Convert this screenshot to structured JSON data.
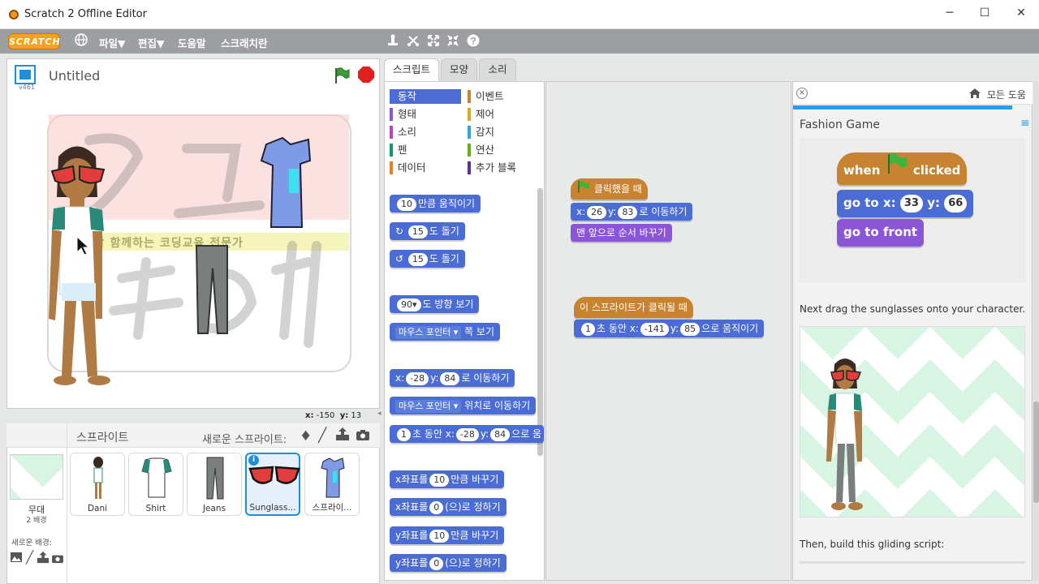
{
  "window": {
    "title": "Scratch 2 Offline Editor",
    "controls": [
      "─",
      "☐",
      "✕"
    ]
  },
  "menubar": {
    "logo": "SCRATCH",
    "file": "파일▼",
    "edit": "편집▼",
    "help": "도움말",
    "tips": "스크래치란"
  },
  "stage": {
    "title": "Untitled",
    "version": "v461",
    "coords_x_label": "x:",
    "coords_x": "-150",
    "coords_y_label": "y:",
    "coords_y": "13",
    "watermark_line1": "강의학 함께하는 코딩교육 전문가"
  },
  "sprites_panel": {
    "title": "스프라이트",
    "new_sprite": "새로운 스프라이트:",
    "stage_label": "무대",
    "stage_sub": "2 배경",
    "new_backdrop": "새로운 배경:",
    "items": [
      {
        "name": "Dani"
      },
      {
        "name": "Shirt"
      },
      {
        "name": "Jeans"
      },
      {
        "name": "Sunglass..."
      },
      {
        "name": "스프라이..."
      }
    ]
  },
  "tabs": [
    "스크립트",
    "모양",
    "소리"
  ],
  "palette": {
    "categories_left": [
      "동작",
      "형태",
      "소리",
      "펜",
      "데이터"
    ],
    "categories_right": [
      "이벤트",
      "제어",
      "감지",
      "연산",
      "추가 블록"
    ],
    "colors_left": [
      "#4a6cd4",
      "#8a55d7",
      "#bb42c3",
      "#0e9a6c",
      "#ee7d16"
    ],
    "colors_right": [
      "#c88330",
      "#e1a91a",
      "#2ca5e2",
      "#5cb712",
      "#632d99"
    ],
    "blocks": {
      "move_n": "10",
      "move_t": "만큼 움직이기",
      "turn_right_n": "15",
      "turn_right_t": "도 돌기",
      "turn_left_n": "15",
      "turn_left_t": "도 돌기",
      "point_dir_n": "90▾",
      "point_dir_t": "도 방향 보기",
      "point_towards_v": "마우스 포인터 ▾",
      "point_towards_t": "쪽 보기",
      "goto_x_l": "x:",
      "goto_x": "-28",
      "goto_y_l": "y:",
      "goto_y": "84",
      "goto_t": "로 이동하기",
      "goto_target_v": "마우스 포인터 ▾",
      "goto_target_t": "위치로 이동하기",
      "glide_n": "1",
      "glide_t1": "초 동안 x:",
      "glide_x": "-28",
      "glide_y_l": "y:",
      "glide_y": "84",
      "glide_t2": "으로 움",
      "changex_l": "x좌표를",
      "changex_n": "10",
      "changex_t": "만큼 바꾸기",
      "setx_l": "x좌표를",
      "setx_n": "0",
      "setx_t": "(으)로 정하기",
      "changey_l": "y좌표를",
      "changey_n": "10",
      "changey_t": "만큼 바꾸기",
      "sety_l": "y좌표를",
      "sety_n": "0",
      "sety_t": "(으)로 정하기"
    }
  },
  "scripts": {
    "s1_hat": "클릭했을 때",
    "s1_goto_xl": "x:",
    "s1_goto_x": "26",
    "s1_goto_yl": "y:",
    "s1_goto_y": "83",
    "s1_goto_t": "로 이동하기",
    "s1_front": "맨 앞으로 순서 바꾸기",
    "s2_hat": "이 스프라이트가 클릭될 때",
    "s2_n": "1",
    "s2_t1": "초 동안 x:",
    "s2_x": "-141",
    "s2_yl": "y:",
    "s2_y": "85",
    "s2_t2": "으로 움직이기"
  },
  "help": {
    "all_help": "모든 도움",
    "title": "Fashion Game",
    "when": "when",
    "clicked": "clicked",
    "goto": "go to x:",
    "goto_x": "33",
    "goto_yl": "y:",
    "goto_y": "66",
    "front": "go to front",
    "instr1": "Next drag the sunglasses onto your character.",
    "instr2": "Then, build this gliding script:"
  }
}
